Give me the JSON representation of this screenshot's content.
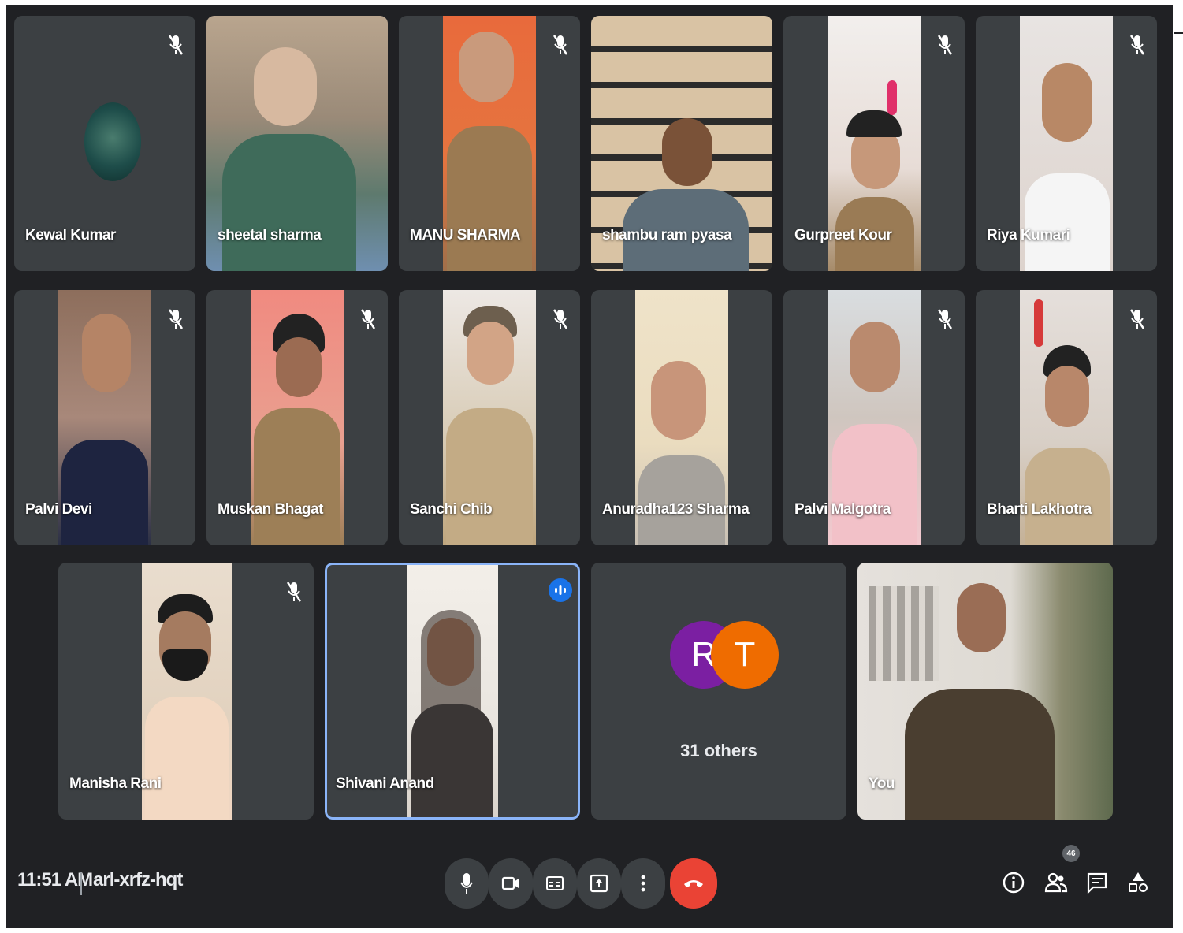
{
  "meeting": {
    "time": "11:51 AM",
    "code": "arl-xrfz-hqt",
    "people_count": "46"
  },
  "participants": [
    {
      "name": "Kewal Kumar",
      "muted": true
    },
    {
      "name": "sheetal sharma",
      "muted": false
    },
    {
      "name": "MANU SHARMA",
      "muted": true
    },
    {
      "name": "shambu ram pyasa",
      "muted": false
    },
    {
      "name": "Gurpreet Kour",
      "muted": true
    },
    {
      "name": "Riya Kumari",
      "muted": true
    },
    {
      "name": "Palvi Devi",
      "muted": true
    },
    {
      "name": "Muskan Bhagat",
      "muted": true
    },
    {
      "name": "Sanchi Chib",
      "muted": true
    },
    {
      "name": "Anuradha123 Sharma",
      "muted": false
    },
    {
      "name": "Palvi Malgotra",
      "muted": true
    },
    {
      "name": "Bharti Lakhotra",
      "muted": true
    },
    {
      "name": "Manisha Rani",
      "muted": true
    },
    {
      "name": "Shivani Anand",
      "muted": false,
      "speaking": true
    },
    {
      "name": "You",
      "muted": false
    }
  ],
  "others": {
    "label": "31 others",
    "avatars": [
      {
        "letter": "R",
        "color": "#7b1fa2"
      },
      {
        "letter": "T",
        "color": "#ef6c00"
      }
    ]
  },
  "controls": {
    "center": [
      "microphone-icon",
      "camera-icon",
      "captions-icon",
      "present-screen-icon",
      "more-options-icon",
      "leave-call-icon"
    ],
    "right": [
      "meeting-info-icon",
      "people-icon",
      "chat-icon",
      "activities-icon"
    ]
  },
  "colors": {
    "background": "#202124",
    "tile": "#3c4043",
    "active_border": "#8ab4f8",
    "speaking": "#1a73e8",
    "end_call": "#ea4335"
  }
}
